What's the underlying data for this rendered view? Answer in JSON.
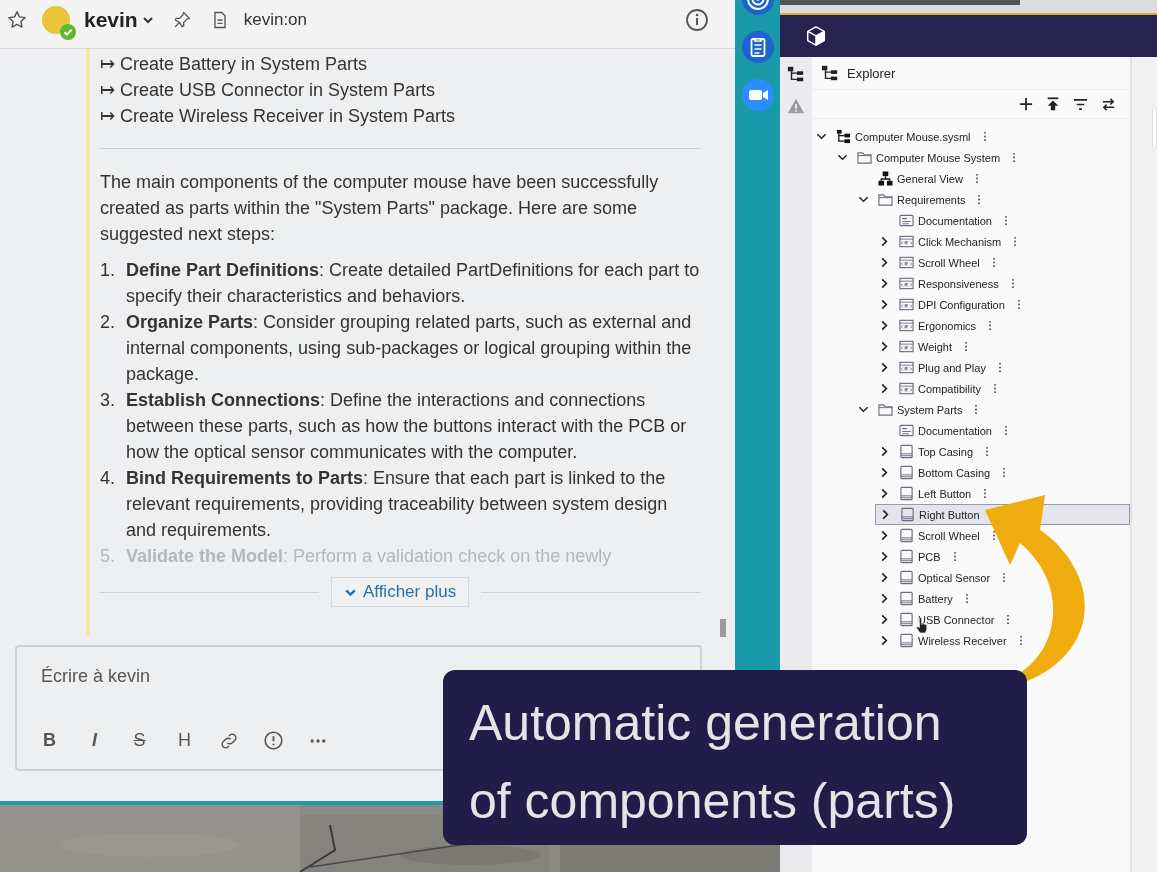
{
  "chat_header": {
    "name": "kevin",
    "online": true,
    "topic": "kevin:on"
  },
  "message": {
    "actions": [
      "↦ Create Battery in System Parts",
      "↦ Create USB Connector in System Parts",
      "↦ Create Wireless Receiver in System Parts"
    ],
    "intro": "The main components of the computer mouse have been successfully created as parts within the \"System Parts\" package. Here are some suggested next steps:",
    "steps": [
      {
        "number": "1.",
        "text": "**Define Part Definitions**: Create detailed PartDefinitions for each part to specify their characteristics and behaviors.",
        "faded": false
      },
      {
        "number": "2.",
        "text": "**Organize Parts**: Consider grouping related parts, such as external and internal components, using sub-packages or logical grouping within the package.",
        "faded": false
      },
      {
        "number": "3.",
        "text": "**Establish Connections**: Define the interactions and connections between these parts, such as how the buttons interact with the PCB or how the optical sensor communicates with the computer.",
        "faded": false
      },
      {
        "number": "4.",
        "text": "**Bind Requirements to Parts**: Ensure that each part is linked to the relevant requirements, providing traceability between system design and requirements.",
        "faded": false
      },
      {
        "number": "5.",
        "text": "**Validate the Model**: Perform a validation check on the newly",
        "faded": true
      }
    ],
    "show_more": "Afficher plus"
  },
  "composer": {
    "placeholder": "Écrire à kevin",
    "toolbar": [
      {
        "kind": "bold",
        "label": "B"
      },
      {
        "kind": "italic",
        "label": "I"
      },
      {
        "kind": "strike",
        "label": "S"
      },
      {
        "kind": "heading",
        "label": "H"
      },
      {
        "kind": "link"
      },
      {
        "kind": "alert"
      },
      {
        "kind": "more"
      }
    ]
  },
  "explorer": {
    "title": "Explorer",
    "tree": [
      {
        "label": "Computer Mouse.sysml",
        "kind": "file",
        "expanded": true,
        "selected": false,
        "children": [
          {
            "label": "Computer Mouse System",
            "kind": "package",
            "expanded": true,
            "selected": false,
            "children": [
              {
                "label": "General View",
                "kind": "diagram",
                "selected": false
              },
              {
                "label": "Requirements",
                "kind": "package",
                "expanded": true,
                "selected": false,
                "children": [
                  {
                    "label": "Documentation",
                    "kind": "documentation",
                    "selected": false
                  },
                  {
                    "label": "Click Mechanism",
                    "kind": "requirement",
                    "expanded": false,
                    "selected": false
                  },
                  {
                    "label": "Scroll Wheel",
                    "kind": "requirement",
                    "expanded": false,
                    "selected": false
                  },
                  {
                    "label": "Responsiveness",
                    "kind": "requirement",
                    "expanded": false,
                    "selected": false
                  },
                  {
                    "label": "DPI Configuration",
                    "kind": "requirement",
                    "expanded": false,
                    "selected": false
                  },
                  {
                    "label": "Ergonomics",
                    "kind": "requirement",
                    "expanded": false,
                    "selected": false
                  },
                  {
                    "label": "Weight",
                    "kind": "requirement",
                    "expanded": false,
                    "selected": false
                  },
                  {
                    "label": "Plug and Play",
                    "kind": "requirement",
                    "expanded": false,
                    "selected": false
                  },
                  {
                    "label": "Compatibility",
                    "kind": "requirement",
                    "expanded": false,
                    "selected": false
                  }
                ]
              },
              {
                "label": "System Parts",
                "kind": "package",
                "expanded": true,
                "selected": false,
                "children": [
                  {
                    "label": "Documentation",
                    "kind": "documentation",
                    "selected": false
                  },
                  {
                    "label": "Top Casing",
                    "kind": "part",
                    "expanded": false,
                    "selected": false
                  },
                  {
                    "label": "Bottom Casing",
                    "kind": "part",
                    "expanded": false,
                    "selected": false
                  },
                  {
                    "label": "Left Button",
                    "kind": "part",
                    "expanded": false,
                    "selected": false
                  },
                  {
                    "label": "Right Button",
                    "kind": "part",
                    "expanded": false,
                    "selected": true
                  },
                  {
                    "label": "Scroll Wheel",
                    "kind": "part",
                    "expanded": false,
                    "selected": false
                  },
                  {
                    "label": "PCB",
                    "kind": "part",
                    "expanded": false,
                    "selected": false
                  },
                  {
                    "label": "Optical Sensor",
                    "kind": "part",
                    "expanded": false,
                    "selected": false
                  },
                  {
                    "label": "Battery",
                    "kind": "part",
                    "expanded": false,
                    "selected": false
                  },
                  {
                    "label": "USB Connector",
                    "kind": "part",
                    "expanded": false,
                    "selected": false
                  },
                  {
                    "label": "Wireless Receiver",
                    "kind": "part",
                    "expanded": false,
                    "selected": false
                  }
                ]
              }
            ]
          }
        ]
      }
    ]
  },
  "caption": {
    "lines": [
      "Automatic generation",
      "of components (parts)"
    ]
  }
}
